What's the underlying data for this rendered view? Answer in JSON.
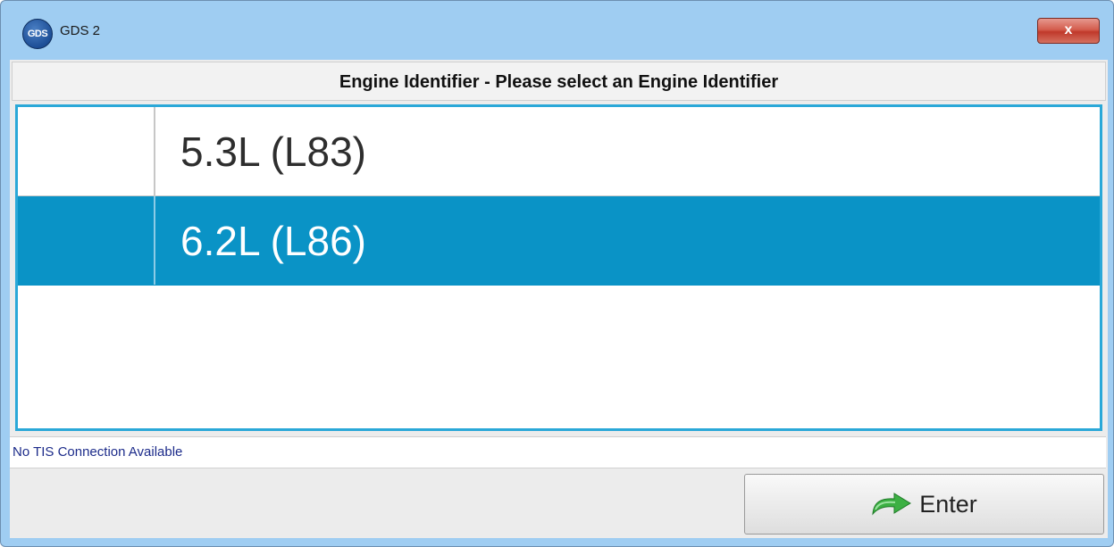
{
  "window": {
    "app_icon_text": "GDS",
    "title": "GDS 2",
    "close_label": "x"
  },
  "dialog": {
    "header": "Engine Identifier - Please select an Engine Identifier",
    "options": [
      {
        "label": "5.3L (L83)",
        "selected": false
      },
      {
        "label": "6.2L (L86)",
        "selected": true
      }
    ],
    "status_text": "No TIS Connection Available",
    "enter_label": "Enter"
  },
  "colors": {
    "selection": "#0a93c6",
    "list_border": "#2aa8d8",
    "title_bar": "#9fcdf2"
  },
  "icons": {
    "enter": "green-curved-arrow-icon",
    "close": "close-icon"
  }
}
